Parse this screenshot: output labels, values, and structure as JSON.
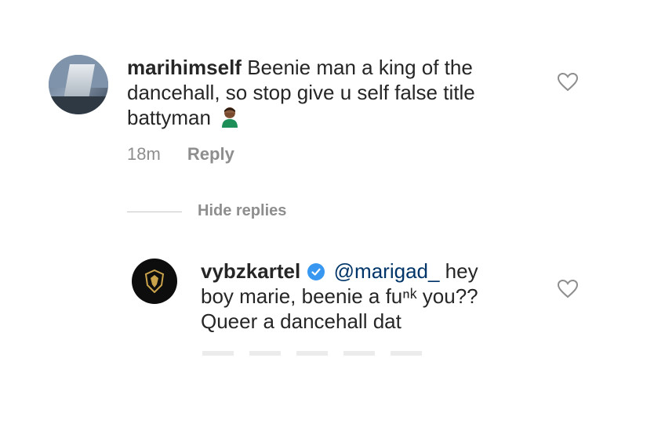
{
  "comment": {
    "username": "marihimself",
    "text_line1": "Beenie man a king of the",
    "text_line2": "dancehall, so stop give u self false title",
    "text_line3": "battyman",
    "time": "18m",
    "reply_label": "Reply",
    "avatar_icon": "profile-photo-building",
    "emoji_icon": "person-facepalming-emoji"
  },
  "hide_replies_label": "Hide replies",
  "reply": {
    "username": "vybzkartel",
    "verified_icon": "verified-badge-icon",
    "mention": "@marigad_",
    "text_after_mention": " hey",
    "text_line2": "boy marie, beenie a fuⁿᵏ you??",
    "text_line3": "Queer a dancehall dat",
    "avatar_icon": "profile-crest-logo"
  },
  "colors": {
    "text": "#262626",
    "muted": "#8e8e8e",
    "verified": "#3897f0",
    "mention": "#003569"
  }
}
